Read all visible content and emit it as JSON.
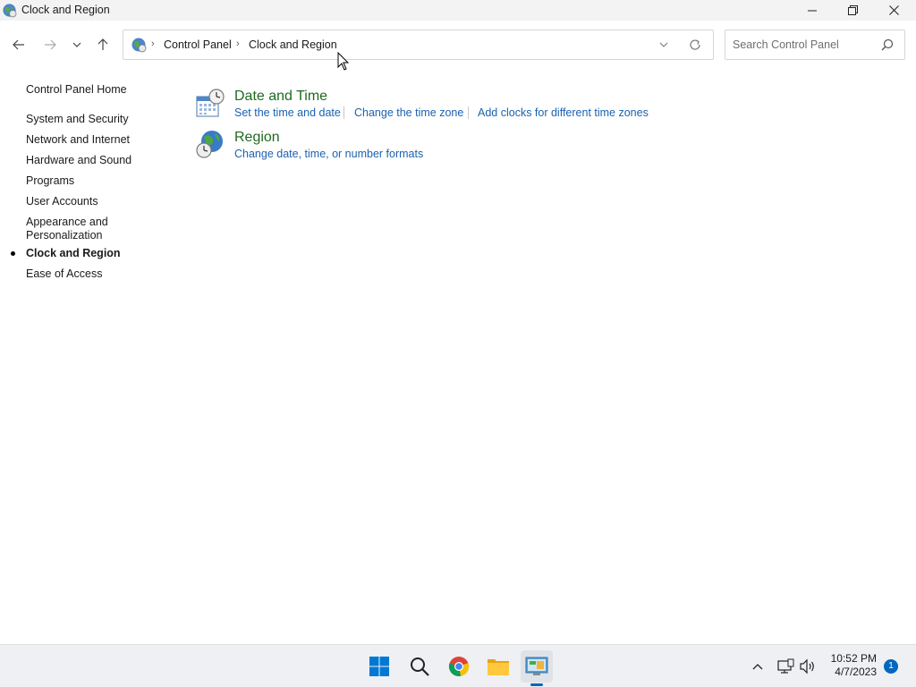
{
  "window": {
    "title": "Clock and Region"
  },
  "navigation": {
    "breadcrumbs": [
      {
        "label": "Control Panel"
      },
      {
        "label": "Clock and Region"
      }
    ],
    "search_placeholder": "Search Control Panel"
  },
  "sidebar": {
    "home_label": "Control Panel Home",
    "items": [
      {
        "label": "System and Security"
      },
      {
        "label": "Network and Internet"
      },
      {
        "label": "Hardware and Sound"
      },
      {
        "label": "Programs"
      },
      {
        "label": "User Accounts"
      },
      {
        "label": "Appearance and Personalization",
        "line1": "Appearance and",
        "line2": "Personalization"
      },
      {
        "label": "Clock and Region",
        "active": true
      },
      {
        "label": "Ease of Access"
      }
    ]
  },
  "main": {
    "categories": [
      {
        "title": "Date and Time",
        "icon": "calendar-clock-icon",
        "tasks": [
          {
            "label": "Set the time and date"
          },
          {
            "label": "Change the time zone"
          },
          {
            "label": "Add clocks for different time zones"
          }
        ]
      },
      {
        "title": "Region",
        "icon": "globe-clock-icon",
        "tasks": [
          {
            "label": "Change date, time, or number formats"
          }
        ]
      }
    ]
  },
  "taskbar": {
    "apps": [
      {
        "name": "start",
        "icon": "windows-logo-icon"
      },
      {
        "name": "search",
        "icon": "search-icon"
      },
      {
        "name": "chrome",
        "icon": "chrome-icon"
      },
      {
        "name": "file-explorer",
        "icon": "folder-icon"
      },
      {
        "name": "control-panel",
        "icon": "control-panel-icon",
        "active": true
      }
    ],
    "tray": {
      "time": "10:52 PM",
      "date": "4/7/2023",
      "notification_count": "1"
    }
  },
  "colors": {
    "link": "#1a62b0",
    "category_title": "#1e6a1e",
    "accent": "#0067c0"
  }
}
